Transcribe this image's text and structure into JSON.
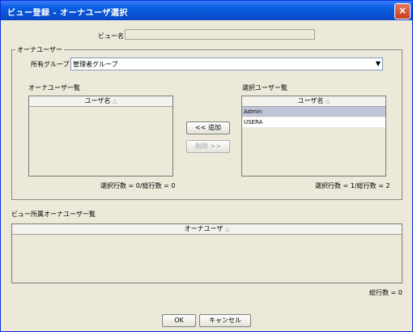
{
  "window": {
    "title": "ビュー登録 - オーナユーザ選択",
    "close_icon": "×"
  },
  "view_name": {
    "label": "ビュー名",
    "value": ""
  },
  "owner_group": {
    "legend": "オーナユーザー",
    "group_label": "所有グループ",
    "group_value": "管理者グループ",
    "dropdown_arrow": "▼"
  },
  "left_list": {
    "title": "オーナユーザ一覧",
    "column_header": "ユーザ名",
    "sort_icon": "△",
    "rows": [],
    "status": "選択行数 = 0/総行数 = 0"
  },
  "buttons": {
    "add": "<< 追加",
    "remove": "削除 >>",
    "ok": "OK",
    "cancel": "キャンセル"
  },
  "right_list": {
    "title": "選択ユーザー覧",
    "column_header": "ユーザ名",
    "sort_icon": "△",
    "rows": [
      "Admin",
      "USERA"
    ],
    "status": "選択行数 = 1/総行数 = 2"
  },
  "bottom_list": {
    "title": "ビュー所属オーナユーザ一覧",
    "column_header": "オーナユーザ",
    "sort_icon": "△",
    "rows": [],
    "status": "総行数 = 0"
  }
}
